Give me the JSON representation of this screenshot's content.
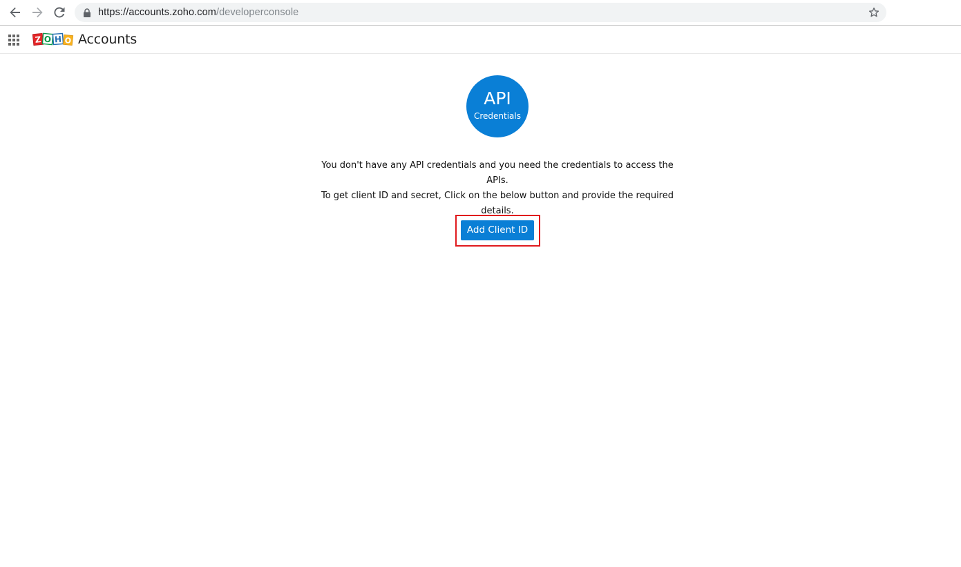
{
  "browser": {
    "url_host": "https://accounts.zoho.com",
    "url_path": "/developerconsole",
    "icons": {
      "back": "arrow-left-icon",
      "forward": "arrow-right-icon",
      "reload": "reload-icon",
      "lock": "lock-icon",
      "bookmark": "star-icon"
    }
  },
  "header": {
    "logo_letters": [
      "Z",
      "O",
      "H",
      "O"
    ],
    "logo_colors": [
      "#e42527",
      "#089949",
      "#226db4",
      "#f9b21d"
    ],
    "app_title": "Accounts",
    "apps_icon": "apps-grid-icon"
  },
  "main": {
    "badge_title": "API",
    "badge_subtitle": "Credentials",
    "message_lines": [
      "You don't have any API credentials and you need the credentials to access the APIs.",
      "To get client ID and secret, Click on the below button and provide the required",
      "details."
    ],
    "add_button_label": "Add Client ID"
  },
  "colors": {
    "primary": "#0a7fd6",
    "highlight_border": "#e0191d"
  }
}
